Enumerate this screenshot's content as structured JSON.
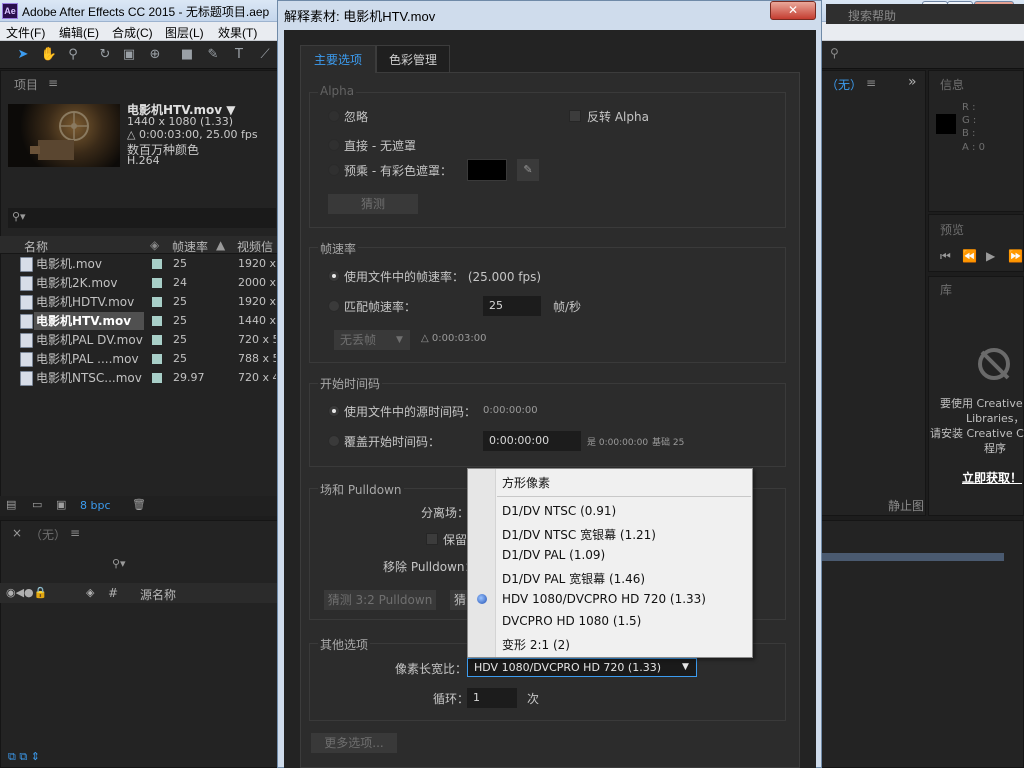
{
  "app": {
    "title": "Adobe After Effects CC 2015 - 无标题项目.aep",
    "logo": "Ae",
    "window_buttons": {
      "minimize": "–",
      "maximize": "▢",
      "close": "✕"
    }
  },
  "menu": [
    "文件(F)",
    "编辑(E)",
    "合成(C)",
    "图层(L)",
    "效果(T)"
  ],
  "toolbar": {
    "search_help": "搜索帮助"
  },
  "project": {
    "header": "项目",
    "header_menu": "≡",
    "selected": {
      "name": "电影机HTV.mov ▼",
      "size": "1440 x 1080 (1.33)",
      "duration": "△ 0:00:03:00, 25.00 fps",
      "color": "数百万种颜色",
      "codec": "H.264"
    },
    "search_icon": "⚲▾",
    "columns": {
      "name": "名称",
      "fps": "帧速率",
      "video": "视频信"
    },
    "items": [
      {
        "name": "电影机.mov",
        "fps": "25",
        "res": "1920 x"
      },
      {
        "name": "电影机2K.mov",
        "fps": "24",
        "res": "2000 x"
      },
      {
        "name": "电影机HDTV.mov",
        "fps": "25",
        "res": "1920 x"
      },
      {
        "name": "电影机HTV.mov",
        "fps": "25",
        "res": "1440 x"
      },
      {
        "name": "电影机PAL DV.mov",
        "fps": "25",
        "res": "720 x 5"
      },
      {
        "name": "电影机PAL ....mov",
        "fps": "25",
        "res": "788 x 5"
      },
      {
        "name": "电影机NTSC...mov",
        "fps": "29.97",
        "res": "720 x 4"
      }
    ],
    "footer_bpc": "8 bpc"
  },
  "timeline": {
    "tab": "（无）",
    "tab_close": "×",
    "menu": "≡",
    "source_name_col": "源名称",
    "hash_col": "#"
  },
  "comp_panel": {
    "tab": "（无）",
    "menu": "≡",
    "chevrons": "»"
  },
  "info": {
    "title": "信息",
    "r": "R :",
    "g": "G :",
    "b": "B :",
    "a": "A : 0"
  },
  "preview": {
    "title": "预览"
  },
  "library": {
    "title": "库",
    "msg1": "要使用 Creative",
    "msg2": "Libraries，",
    "msg3": "请安装 Creative Clo",
    "msg4": "程序",
    "install": "立即获取！"
  },
  "lower_right": {
    "static_label": "静止图"
  },
  "dialog": {
    "title": "解释素材: 电影机HTV.mov",
    "close": "✕",
    "tabs": {
      "main": "主要选项",
      "color": "色彩管理"
    },
    "alpha": {
      "title": "Alpha",
      "ignore": "忽略",
      "invert": "反转 Alpha",
      "straight": "直接 - 无遮罩",
      "premultiplied": "预乘 - 有彩色遮罩：",
      "guess": "猜测"
    },
    "framerate": {
      "title": "帧速率",
      "use_file": "使用文件中的帧速率：  (25.000 fps)",
      "conform": "匹配帧速率：",
      "conform_value": "25",
      "unit": "帧/秒",
      "dropframe": "无丢帧",
      "duration": "△ 0:00:03:00"
    },
    "timecode": {
      "title": "开始时间码",
      "use_source": "使用文件中的源时间码：",
      "source_value": "0:00:00:00",
      "override": "覆盖开始时间码：",
      "override_value": "0:00:00:00",
      "is_label": "是 0:00:00:00",
      "base_label": "基础 25"
    },
    "fields": {
      "title": "场和 Pulldown",
      "separate": "分离场：",
      "preserve": "保留",
      "remove": "移除 Pulldown：",
      "guess_pulldown": "猜测 3:2 Pulldown",
      "guess2": "猜"
    },
    "other": {
      "title": "其他选项",
      "par_label": "像素长宽比：",
      "par_value": "HDV 1080/DVCPRO HD 720 (1.33)",
      "loop_label": "循环：",
      "loop_value": "1",
      "loop_unit": "次"
    },
    "more": "更多选项..."
  },
  "par_options": [
    "方形像素",
    "D1/DV NTSC (0.91)",
    "D1/DV NTSC 宽银幕 (1.21)",
    "D1/DV PAL (1.09)",
    "D1/DV PAL 宽银幕 (1.46)",
    "HDV 1080/DVCPRO HD 720 (1.33)",
    "DVCPRO HD 1080 (1.5)",
    "变形 2:1 (2)"
  ],
  "colors": {
    "accent": "#3c9cf0",
    "panel": "#232323",
    "dialog_body": "#2c2c2c"
  }
}
